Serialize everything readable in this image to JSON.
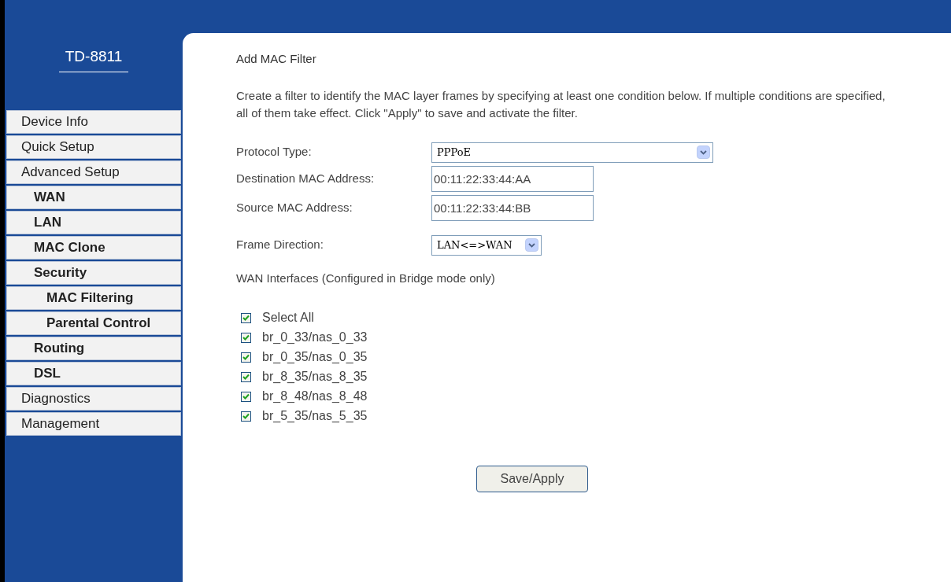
{
  "brand": "TD-8811",
  "sidebar": {
    "items": [
      {
        "label": "Device Info"
      },
      {
        "label": "Quick Setup"
      },
      {
        "label": "Advanced Setup",
        "children": [
          {
            "label": "WAN"
          },
          {
            "label": "LAN"
          },
          {
            "label": "MAC Clone"
          },
          {
            "label": "Security",
            "children": [
              {
                "label": "MAC Filtering"
              },
              {
                "label": "Parental Control"
              }
            ]
          },
          {
            "label": "Routing"
          },
          {
            "label": "DSL"
          }
        ]
      },
      {
        "label": "Diagnostics"
      },
      {
        "label": "Management"
      }
    ]
  },
  "page": {
    "title": "Add MAC Filter",
    "description": "Create a filter to identify the MAC layer frames by specifying at least one condition below. If multiple conditions are specified, all of them take effect. Click \"Apply\" to save and activate the filter.",
    "fields": [
      {
        "kind": "select",
        "label": "Protocol Type:",
        "value": "PPPoE"
      },
      {
        "kind": "text",
        "label": "Destination MAC Address:",
        "value": "00:11:22:33:44:AA"
      },
      {
        "kind": "text",
        "label": "Source MAC Address:",
        "value": "00:11:22:33:44:BB"
      },
      {
        "kind": "select",
        "label": "Frame Direction:",
        "value": "LAN<=>WAN"
      }
    ],
    "wan_heading": "WAN Interfaces (Configured in Bridge mode only)",
    "checkboxes": [
      {
        "label": "Select All",
        "checked": true
      },
      {
        "label": "br_0_33/nas_0_33",
        "checked": true
      },
      {
        "label": "br_0_35/nas_0_35",
        "checked": true
      },
      {
        "label": "br_8_35/nas_8_35",
        "checked": true
      },
      {
        "label": "br_8_48/nas_8_48",
        "checked": true
      },
      {
        "label": "br_5_35/nas_5_35",
        "checked": true
      }
    ],
    "button": "Save/Apply"
  }
}
